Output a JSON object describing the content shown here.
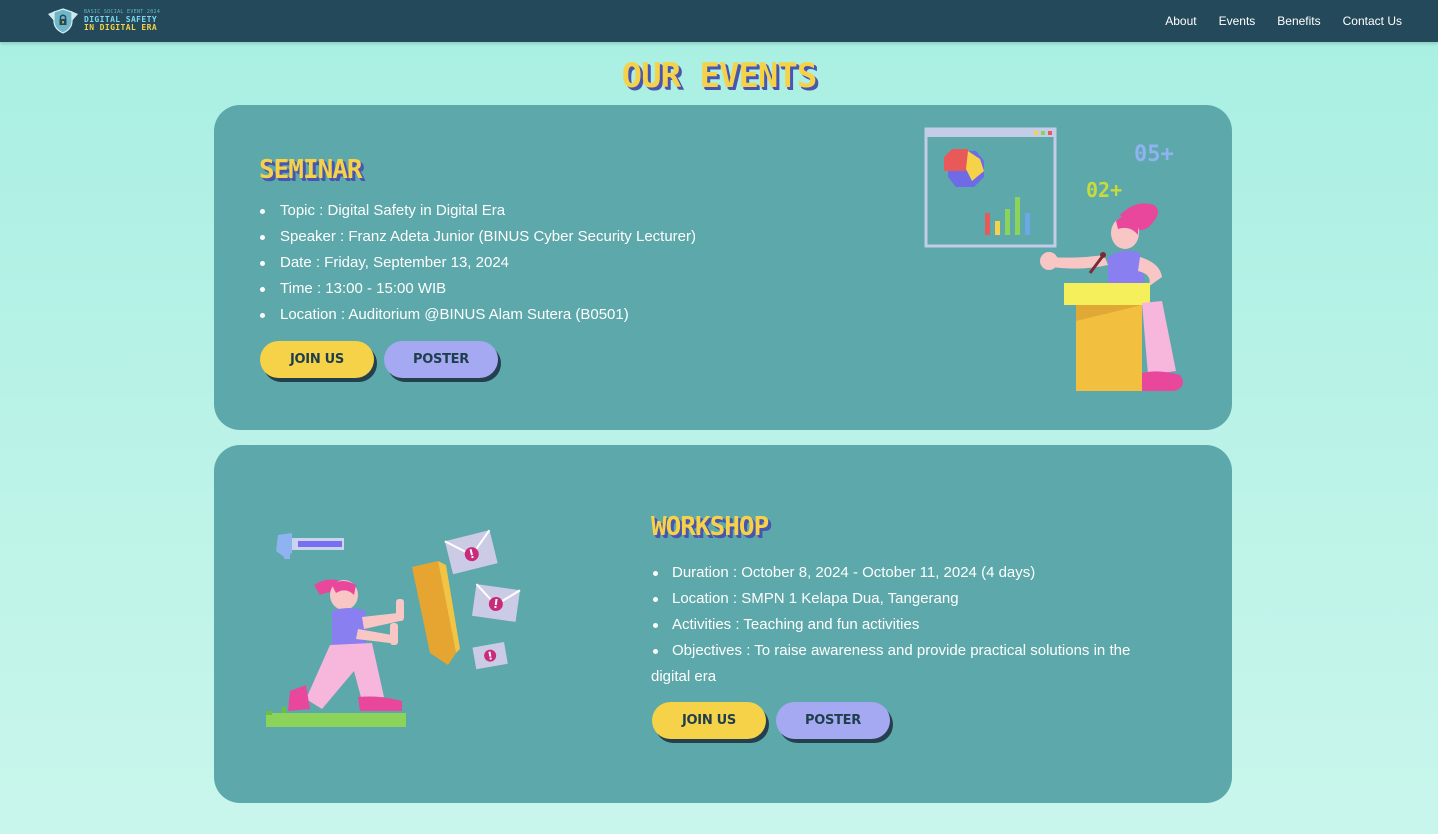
{
  "nav": {
    "brand_small": "BASIC SOCIAL EVENT 2024",
    "brand_line1": "DIGITAL SAFETY",
    "brand_line2": "IN DIGITAL ERA",
    "links": [
      "About",
      "Events",
      "Benefits",
      "Contact Us"
    ]
  },
  "section_title": "OUR EVENTS",
  "seminar": {
    "heading": "SEMINAR",
    "items": [
      "Topic : Digital Safety in Digital Era",
      "Speaker : Franz Adeta Junior (BINUS Cyber Security Lecturer)",
      "Date : Friday, September 13, 2024",
      "Time : 13:00 - 15:00 WIB",
      "Location : Auditorium @BINUS Alam Sutera (B0501)"
    ],
    "join_label": "JOIN US",
    "poster_label": "POSTER",
    "illustration_labels": [
      "05+",
      "02+"
    ]
  },
  "workshop": {
    "heading": "WORKSHOP",
    "items": [
      "Duration : October 8, 2024 - October 11, 2024 (4 days)",
      "Location : SMPN 1 Kelapa Dua, Tangerang",
      "Activities : Teaching and fun activities",
      "Objectives : To raise awareness and provide practical solutions in the digital era"
    ],
    "join_label": "JOIN US",
    "poster_label": "POSTER"
  },
  "colors": {
    "navbar": "#24495a",
    "card": "#5da8aa",
    "accent_yellow": "#f6d248",
    "accent_lavender": "#a4a9f2",
    "title_shadow": "#4a55b0"
  },
  "icons": [
    "shield-lock-logo-icon",
    "presentation-board-icon",
    "speaker-podium-illustration",
    "shield-blocking-emails-illustration"
  ]
}
